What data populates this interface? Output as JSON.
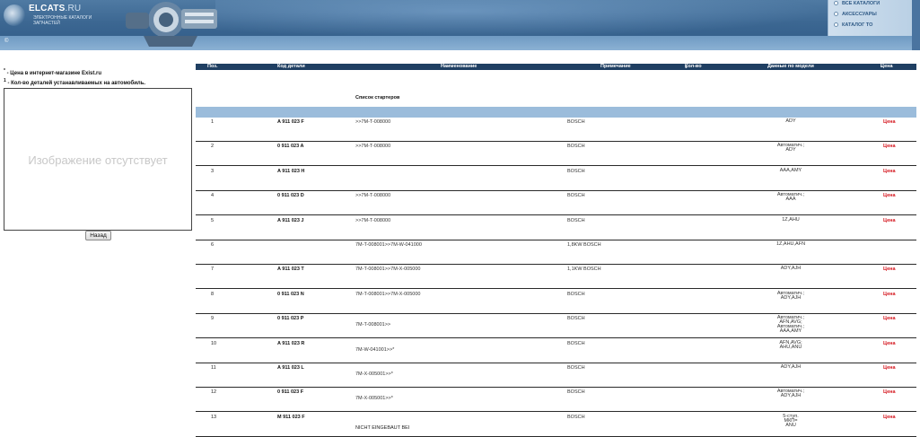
{
  "header": {
    "logo_text": "ELCATS",
    "logo_domain": ".RU",
    "logo_subtitle": "ЭЛЕКТРОННЫЕ КАТАЛОГИ ЗАПЧАСТЕЙ",
    "copyright_symbol": "©",
    "menu": [
      {
        "label": "ВСЕ КАТАЛОГИ"
      },
      {
        "label": "АКСЕССУАРЫ"
      },
      {
        "label": "КАТАЛОГ ТО"
      }
    ],
    "colors": {
      "header_dark": "#2f5a86",
      "header_light": "#8bb1d4",
      "table_header": "#1f3f62",
      "group_band": "#9bbcdb",
      "price": "#d4141c"
    }
  },
  "notes": {
    "price_mark": "*",
    "price_note": " - Цена в интернет-магазине Exist.ru",
    "qty_mark": "1",
    "qty_note": " - Кол-во деталей устанавливаемых на автомобиль."
  },
  "image_placeholder": "Изображение отсутствует",
  "back_button": "Назад",
  "table": {
    "columns": {
      "pos": "Поз.",
      "code": "Код детали",
      "name": "Наименование",
      "note": "Примечание",
      "qty": "Кол-во",
      "qty_mark": "1",
      "model": "Данные по модели",
      "price": "Цена",
      "price_mark": "*"
    },
    "group_title": "Список стартеров",
    "rows": [
      {
        "num": "1",
        "code": "A 911 023 F",
        "name": ">>7M-T-008000",
        "note": "BOSCH",
        "model": [
          "ADY"
        ],
        "price": "Цена"
      },
      {
        "num": "2",
        "code": "0 911 023 A",
        "name": ">>7M-T-008000",
        "note": "BOSCH",
        "model": [
          "Автоматич.;",
          "ADY"
        ],
        "price": "Цена"
      },
      {
        "num": "3",
        "code": "A 911 023 H",
        "name": "",
        "note": "BOSCH",
        "model": [
          "AAA,AMY"
        ],
        "price": "Цена"
      },
      {
        "num": "4",
        "code": "0 911 023 D",
        "name": ">>7M-T-008000",
        "note": "BOSCH",
        "model": [
          "Автоматич.;",
          "AAA"
        ],
        "price": "Цена"
      },
      {
        "num": "5",
        "code": "A 911 023 J",
        "name": ">>7M-T-008000",
        "note": "BOSCH",
        "model": [
          "1Z,AHU"
        ],
        "price": "Цена"
      },
      {
        "num": "6",
        "code": "",
        "name": "7M-T-008001>>7M-W-041000",
        "note": "1,8KW BOSCH",
        "model": [
          "1Z,AHU,AFN"
        ],
        "price": ""
      },
      {
        "num": "7",
        "code": "A 911 023 T",
        "name": "7M-T-008001>>7M-X-005000",
        "note": "1,1KW BOSCH",
        "model": [
          "ADY,AJH"
        ],
        "price": "Цена"
      },
      {
        "num": "8",
        "code": "0 911 023 N",
        "name": "7M-T-008001>>7M-X-005000",
        "note": "BOSCH",
        "model": [
          "Автоматич.;",
          "ADY,AJH"
        ],
        "price": "Цена"
      },
      {
        "num": "9",
        "code": "0 911 023 P",
        "name": "7M-T-008001>>",
        "note": "BOSCH",
        "model": [
          "Автоматич.;",
          "AFN,AVG;",
          "Автоматич.;",
          "AAA,AMY"
        ],
        "price": "Цена"
      },
      {
        "num": "10",
        "code": "A 911 023 R",
        "name": "7M-W-041001>>*",
        "note": "BOSCH",
        "model": [
          "AFN,AVG;",
          "AHU,ANU"
        ],
        "price": "Цена"
      },
      {
        "num": "11",
        "code": "A 911 023 L",
        "name": "7M-X-005001>>*",
        "note": "BOSCH",
        "model": [
          "ADY,AJH"
        ],
        "price": "Цена"
      },
      {
        "num": "12",
        "code": "0 911 023 F",
        "name": "7M-X-005001>>*",
        "note": "BOSCH",
        "model": [
          "Автоматич.;",
          "ADY,AJH"
        ],
        "price": "Цена"
      },
      {
        "num": "13",
        "code": "M 911 023 F",
        "name": "",
        "note": "BOSCH",
        "model": [
          "5-ступ.",
          "МКП=",
          "ANU"
        ],
        "price": "Цена"
      }
    ],
    "trailing_text": "NICHT EINGEBAUT BEI"
  }
}
